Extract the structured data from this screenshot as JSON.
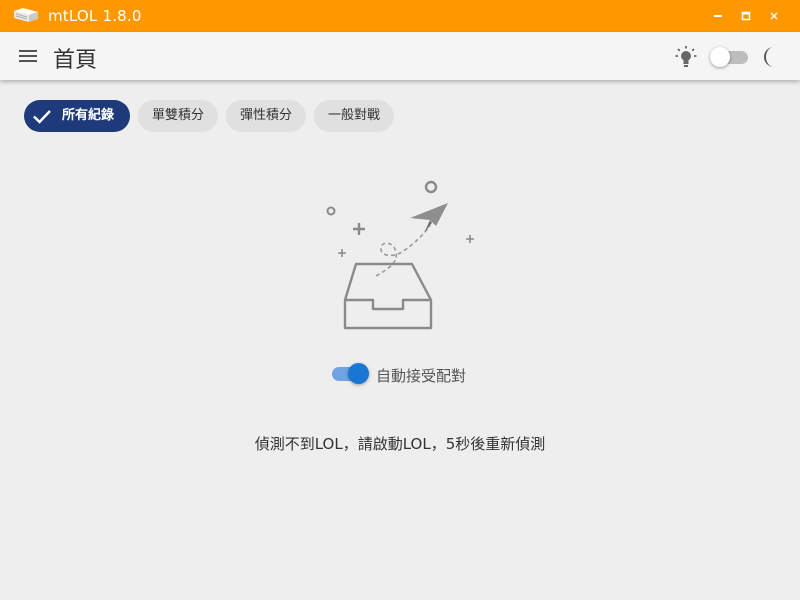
{
  "window": {
    "title": "mtLOL 1.8.0",
    "accent": "#ff9800",
    "controls": [
      "minimize-icon",
      "maximize-icon",
      "close-icon"
    ]
  },
  "appbar": {
    "menu_icon": "hamburger-menu-icon",
    "title": "首頁",
    "light_icon": "lightbulb-icon",
    "dark_icon": "moon-icon",
    "dark_mode": false
  },
  "filters": {
    "selected_color": "#1e3a7a",
    "chips": [
      {
        "label": "所有紀錄",
        "selected": true
      },
      {
        "label": "單雙積分",
        "selected": false
      },
      {
        "label": "彈性積分",
        "selected": false
      },
      {
        "label": "一般對戰",
        "selected": false
      }
    ]
  },
  "empty_state": {
    "illustration": "paper-plane-inbox-illustration"
  },
  "auto_accept": {
    "label": "自動接受配對",
    "enabled": true,
    "color": "#1976d2"
  },
  "status": {
    "message": "偵測不到LOL，請啟動LOL，5秒後重新偵測"
  }
}
